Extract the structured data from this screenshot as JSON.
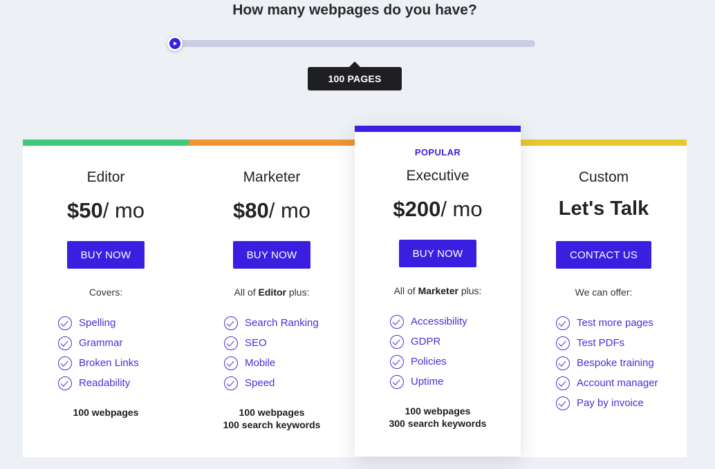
{
  "header": {
    "question": "How many webpages do you have?",
    "tooltip": "100 PAGES",
    "slider_value_fraction": 0.0
  },
  "plans": [
    {
      "accent": "#3ec87a",
      "name": "Editor",
      "price_amount": "$50",
      "price_suffix": "/ mo",
      "button": "BUY NOW",
      "intro_text": "Covers:",
      "features": [
        "Spelling",
        "Grammar",
        "Broken Links",
        "Readability"
      ],
      "footer_lines": [
        "100 webpages"
      ]
    },
    {
      "accent": "#ee9632",
      "name": "Marketer",
      "price_amount": "$80",
      "price_suffix": "/ mo",
      "button": "BUY NOW",
      "intro_prefix": "All of",
      "intro_bold": "Editor",
      "intro_suffix": "plus:",
      "features": [
        "Search Ranking",
        "SEO",
        "Mobile",
        "Speed"
      ],
      "footer_lines": [
        "100 webpages",
        "100 search keywords"
      ]
    },
    {
      "accent": "#3b1fe0",
      "badge": "POPULAR",
      "name": "Executive",
      "price_amount": "$200",
      "price_suffix": "/ mo",
      "button": "BUY NOW",
      "intro_prefix": "All of",
      "intro_bold": "Marketer",
      "intro_suffix": "plus:",
      "features": [
        "Accessibility",
        "GDPR",
        "Policies",
        "Uptime"
      ],
      "footer_lines": [
        "100 webpages",
        "300 search keywords"
      ]
    },
    {
      "accent": "#e8c62e",
      "name": "Custom",
      "price_text": "Let's Talk",
      "button": "CONTACT US",
      "intro_text": "We can offer:",
      "features": [
        "Test more pages",
        "Test PDFs",
        "Bespoke training",
        "Account manager",
        "Pay by invoice"
      ]
    }
  ],
  "colors": {
    "brand": "#3b1fe0",
    "feature_text": "#4630d6",
    "background": "#edf0f4"
  }
}
